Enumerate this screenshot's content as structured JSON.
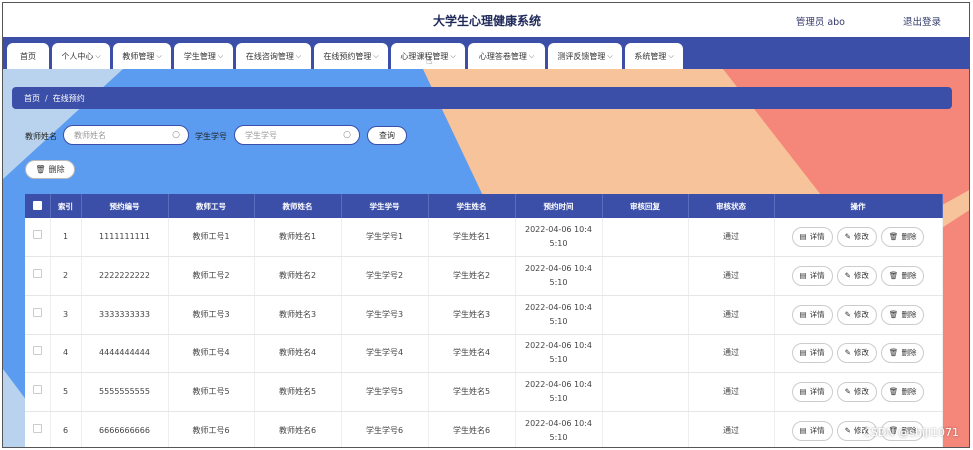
{
  "header": {
    "title": "大学生心理健康系统",
    "user": "管理员 abo",
    "logout": "退出登录"
  },
  "nav": [
    {
      "label": "首页",
      "chevron": false
    },
    {
      "label": "个人中心",
      "chevron": true
    },
    {
      "label": "教师管理",
      "chevron": true
    },
    {
      "label": "学生管理",
      "chevron": true
    },
    {
      "label": "在线咨询管理",
      "chevron": true
    },
    {
      "label": "在线预约管理",
      "chevron": true
    },
    {
      "label": "心理课程管理",
      "chevron": true
    },
    {
      "label": "心理答卷管理",
      "chevron": true
    },
    {
      "label": "测评反馈管理",
      "chevron": true
    },
    {
      "label": "系统管理",
      "chevron": true
    }
  ],
  "breadcrumb": {
    "home": "首页",
    "sep": "/",
    "current": "在线预约"
  },
  "search": {
    "teacher_label": "教师姓名",
    "teacher_placeholder": "教师姓名",
    "student_label": "学生学号",
    "student_placeholder": "学生学号",
    "query_label": "查询"
  },
  "toolbar": {
    "delete_label": "删除"
  },
  "table": {
    "headers": [
      "索引",
      "预约编号",
      "教师工号",
      "教师姓名",
      "学生学号",
      "学生姓名",
      "预约时间",
      "审核回复",
      "审核状态",
      "操作"
    ],
    "rows": [
      {
        "index": "1",
        "code": "1111111111",
        "tid": "教师工号1",
        "tname": "教师姓名1",
        "sid": "学生学号1",
        "sname": "学生姓名1",
        "time": "2022-04-06 10:45:10",
        "reply": "",
        "status": "通过"
      },
      {
        "index": "2",
        "code": "2222222222",
        "tid": "教师工号2",
        "tname": "教师姓名2",
        "sid": "学生学号2",
        "sname": "学生姓名2",
        "time": "2022-04-06 10:45:10",
        "reply": "",
        "status": "通过"
      },
      {
        "index": "3",
        "code": "3333333333",
        "tid": "教师工号3",
        "tname": "教师姓名3",
        "sid": "学生学号3",
        "sname": "学生姓名3",
        "time": "2022-04-06 10:45:10",
        "reply": "",
        "status": "通过"
      },
      {
        "index": "4",
        "code": "4444444444",
        "tid": "教师工号4",
        "tname": "教师姓名4",
        "sid": "学生学号4",
        "sname": "学生姓名4",
        "time": "2022-04-06 10:45:10",
        "reply": "",
        "status": "通过"
      },
      {
        "index": "5",
        "code": "5555555555",
        "tid": "教师工号5",
        "tname": "教师姓名5",
        "sid": "学生学号5",
        "sname": "学生姓名5",
        "time": "2022-04-06 10:45:10",
        "reply": "",
        "status": "通过"
      },
      {
        "index": "6",
        "code": "6666666666",
        "tid": "教师工号6",
        "tname": "教师姓名6",
        "sid": "学生学号6",
        "sname": "学生姓名6",
        "time": "2022-04-06 10:45:10",
        "reply": "",
        "status": "通过"
      }
    ],
    "actions": {
      "detail": "详情",
      "edit": "修改",
      "delete": "删除"
    }
  },
  "watermark": "CSDN @shiji1071",
  "colors": {
    "primary": "#3b4fa8",
    "bg_blue": "#5b9cf0",
    "bg_peach": "#f7c39a",
    "bg_coral": "#f4877a"
  },
  "icons": {
    "search": "search-icon",
    "delete": "trash-icon",
    "detail": "document-icon",
    "edit": "pencil-icon",
    "chevron": "chevron-down-icon"
  }
}
